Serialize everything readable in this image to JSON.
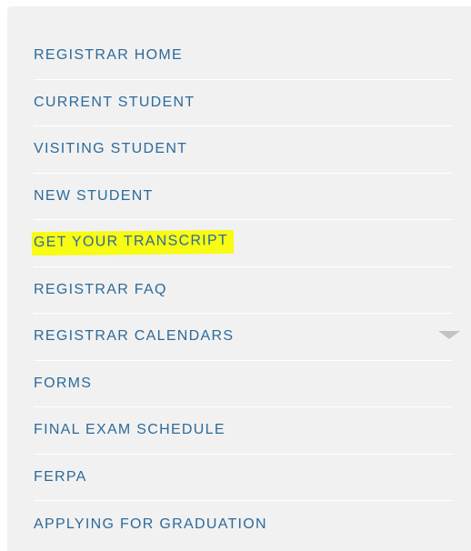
{
  "nav": {
    "items": [
      {
        "label": "REGISTRAR HOME"
      },
      {
        "label": "CURRENT STUDENT"
      },
      {
        "label": "VISITING STUDENT"
      },
      {
        "label": "NEW STUDENT"
      },
      {
        "label": "GET YOUR TRANSCRIPT",
        "highlighted": true
      },
      {
        "label": "REGISTRAR FAQ"
      },
      {
        "label": "REGISTRAR CALENDARS",
        "has_submenu": true,
        "submenu_icon": "chevron-down-icon"
      },
      {
        "label": "FORMS"
      },
      {
        "label": "FINAL EXAM SCHEDULE"
      },
      {
        "label": "FERPA"
      },
      {
        "label": "APPLYING FOR GRADUATION"
      }
    ]
  },
  "colors": {
    "panel_background": "#f1f1f1",
    "link_text": "#2d6a9a",
    "highlight": "#f8fb12",
    "divider": "#ffffff",
    "chevron": "#c3c3c3"
  }
}
